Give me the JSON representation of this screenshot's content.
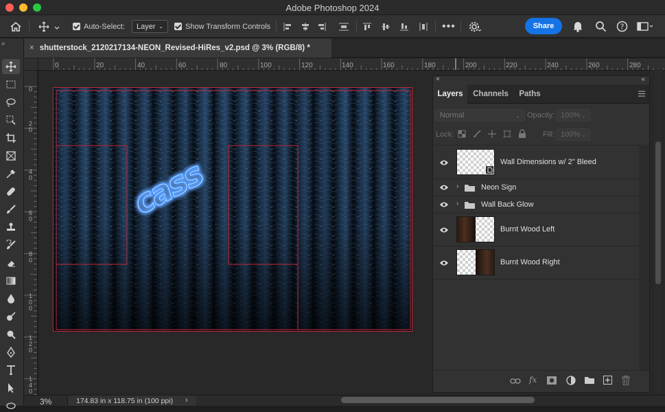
{
  "app_title": "Adobe Photoshop 2024",
  "options_bar": {
    "auto_select_label": "Auto-Select:",
    "auto_select_value": "Layer",
    "transform_label": "Show Transform Controls",
    "share_label": "Share"
  },
  "document": {
    "tab_title": "shutterstock_2120217134-NEON_Revised-HiRes_v2.psd @ 3% (RGB/8) *",
    "canvas_text": "cass"
  },
  "ruler_h": [
    "0",
    "20",
    "40",
    "60",
    "80",
    "100",
    "120",
    "140",
    "160",
    "180",
    "200",
    "220",
    "240",
    "260",
    "280"
  ],
  "ruler_v": [
    [
      "0"
    ],
    [
      "2",
      "0"
    ],
    [
      "4",
      "0"
    ],
    [
      "6",
      "0"
    ],
    [
      "8",
      "0"
    ],
    [
      "1",
      "0",
      "0"
    ],
    [
      "1",
      "2",
      "0"
    ],
    [
      "1",
      "4",
      "0"
    ]
  ],
  "status": {
    "zoom": "3%",
    "doc_info": "174.83 in x 118.75 in (100 ppi)"
  },
  "layers_panel": {
    "tabs": [
      "Layers",
      "Channels",
      "Paths"
    ],
    "blend_mode": "Normal",
    "opacity_label": "Opacity:",
    "opacity_value": "100%",
    "lock_label": "Lock:",
    "fill_label": "Fill:",
    "fill_value": "100%",
    "layers": [
      {
        "name": "Wall Dimensions w/ 2\" Bleed",
        "kind": "smart-object"
      },
      {
        "name": "Neon Sign",
        "kind": "group"
      },
      {
        "name": "Wall Back Glow",
        "kind": "group"
      },
      {
        "name": "Burnt Wood Left",
        "kind": "image"
      },
      {
        "name": "Burnt Wood Right",
        "kind": "image"
      }
    ]
  },
  "colors": {
    "accent": "#1473e6",
    "guide_red": "#c0293a",
    "neon_blue": "#2f8cff"
  }
}
